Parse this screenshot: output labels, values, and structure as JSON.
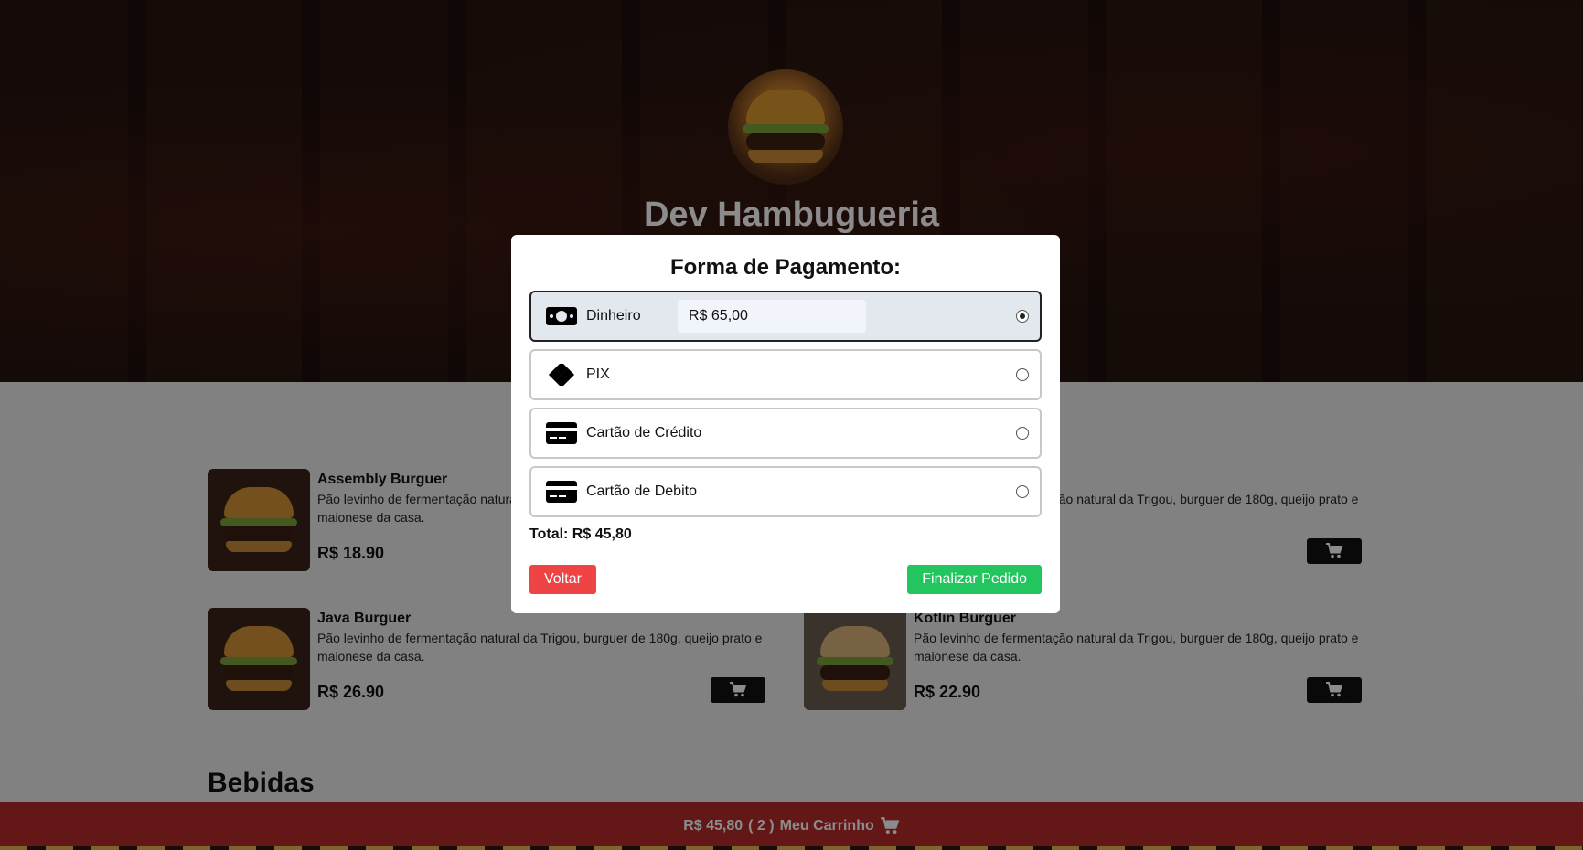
{
  "header": {
    "title": "Dev Hambugueria"
  },
  "menu": {
    "items": [
      {
        "name": "Assembly Burguer",
        "desc": "Pão levinho de fermentação natural da Trigou, burguer de 180g, queijo prato e maionese da casa.",
        "price": "R$ 18.90"
      },
      {
        "name": "Java Burguer",
        "desc": "Pão levinho de fermentação natural da Trigou, burguer de 180g, queijo prato e maionese da casa.",
        "price": "R$ 26.90"
      },
      {
        "name": "",
        "desc": "Pão levinho de fermentação natural da Trigou, burguer de 180g, queijo prato e maionese da casa.",
        "price": ""
      },
      {
        "name": "Kotlin Burguer",
        "desc": "Pão levinho de fermentação natural da Trigou, burguer de 180g, queijo prato e maionese da casa.",
        "price": "R$ 22.90"
      }
    ],
    "section_next": "Bebidas"
  },
  "footer": {
    "cart_total": "R$ 45,80",
    "cart_count": "( 2 )",
    "cart_label": "Meu Carrinho"
  },
  "modal": {
    "title": "Forma de Pagamento:",
    "options": [
      {
        "label": "Dinheiro",
        "icon": "cash-icon",
        "selected": true
      },
      {
        "label": "PIX",
        "icon": "pix-icon",
        "selected": false
      },
      {
        "label": "Cartão de Crédito",
        "icon": "credit-card-icon",
        "selected": false
      },
      {
        "label": "Cartão de Debito",
        "icon": "debit-card-icon",
        "selected": false
      }
    ],
    "cash_value": "R$ 65,00",
    "total": "Total: R$ 45,80",
    "back_label": "Voltar",
    "finish_label": "Finalizar Pedido"
  },
  "colors": {
    "footer_bg": "#b72a2a",
    "back_button": "#ef4444",
    "finish_button": "#22c55e",
    "selected_option_bg": "#e3e7ee"
  }
}
